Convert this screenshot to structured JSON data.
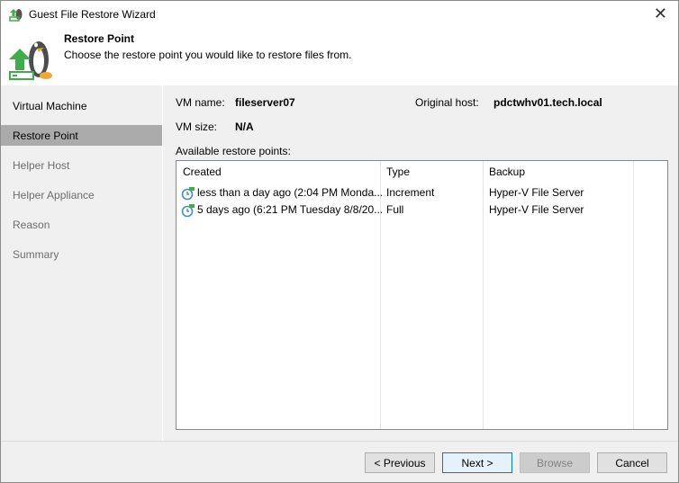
{
  "window": {
    "title": "Guest File Restore Wizard"
  },
  "header": {
    "title": "Restore Point",
    "subtitle": "Choose the restore point you would like to restore files from."
  },
  "sidebar": {
    "items": [
      {
        "label": "Virtual Machine",
        "state": "done"
      },
      {
        "label": "Restore Point",
        "state": "selected"
      },
      {
        "label": "Helper Host",
        "state": "disabled"
      },
      {
        "label": "Helper Appliance",
        "state": "disabled"
      },
      {
        "label": "Reason",
        "state": "disabled"
      },
      {
        "label": "Summary",
        "state": "disabled"
      }
    ]
  },
  "info": {
    "vm_name_label": "VM name:",
    "vm_name": "fileserver07",
    "vm_size_label": "VM size:",
    "vm_size": "N/A",
    "host_label": "Original host:",
    "host": "pdctwhv01.tech.local",
    "list_label": "Available restore points:"
  },
  "table": {
    "columns": [
      "Created",
      "Type",
      "Backup"
    ],
    "rows": [
      {
        "created": "less than a day ago (2:04 PM Monda...",
        "type": "Increment",
        "backup": "Hyper-V File Server"
      },
      {
        "created": "5 days ago (6:21 PM Tuesday 8/8/20...",
        "type": "Full",
        "backup": "Hyper-V File Server"
      }
    ]
  },
  "footer": {
    "previous": "< Previous",
    "next": "Next >",
    "browse": "Browse",
    "cancel": "Cancel"
  }
}
